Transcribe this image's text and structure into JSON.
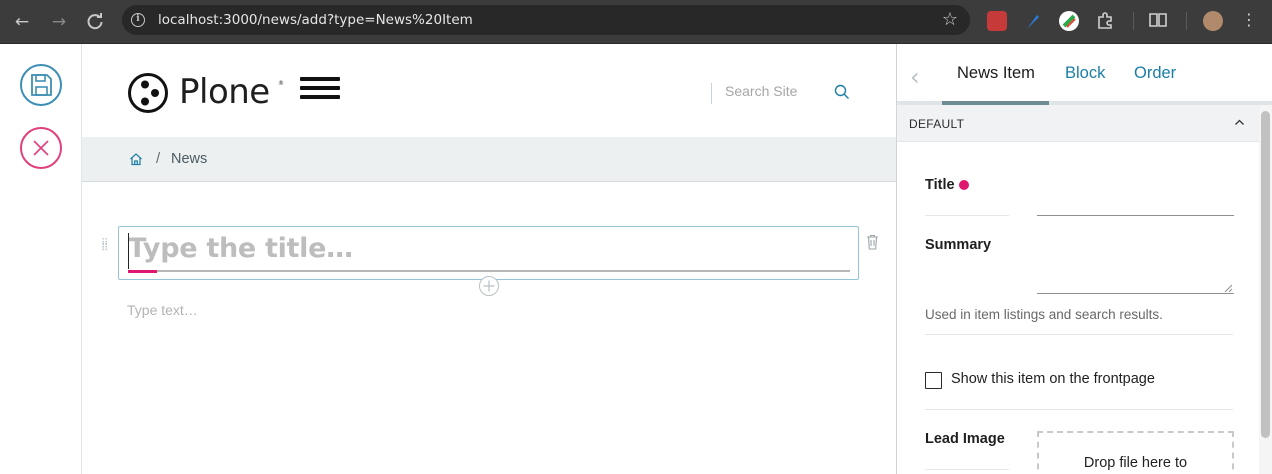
{
  "browser": {
    "url": "localhost:3000/news/add?type=News%20Item",
    "back_icon": "arrow-left-icon",
    "forward_icon": "arrow-right-icon",
    "reload_icon": "reload-icon"
  },
  "header": {
    "logo_text": "Plone",
    "logo_mark": "®",
    "search_placeholder": "Search Site"
  },
  "breadcrumbs": {
    "separator": "/",
    "items": [
      "News"
    ]
  },
  "editor": {
    "title_placeholder": "Type the title…",
    "text_placeholder": "Type text…"
  },
  "sidebar": {
    "tabs": [
      {
        "label": "News Item",
        "active": true
      },
      {
        "label": "Block",
        "active": false
      },
      {
        "label": "Order",
        "active": false
      }
    ],
    "section_label": "DEFAULT",
    "fields": {
      "title_label": "Title",
      "summary_label": "Summary",
      "summary_help": "Used in item listings and search results.",
      "frontpage_label": "Show this item on the frontpage",
      "frontpage_checked": false,
      "lead_image_label": "Lead Image",
      "dropzone_text": "Drop file here to"
    }
  },
  "colors": {
    "accent_blue": "#1a7ea6",
    "save_border": "#3d8fb5",
    "cancel_border": "#e0407b",
    "required": "#e0176e"
  }
}
